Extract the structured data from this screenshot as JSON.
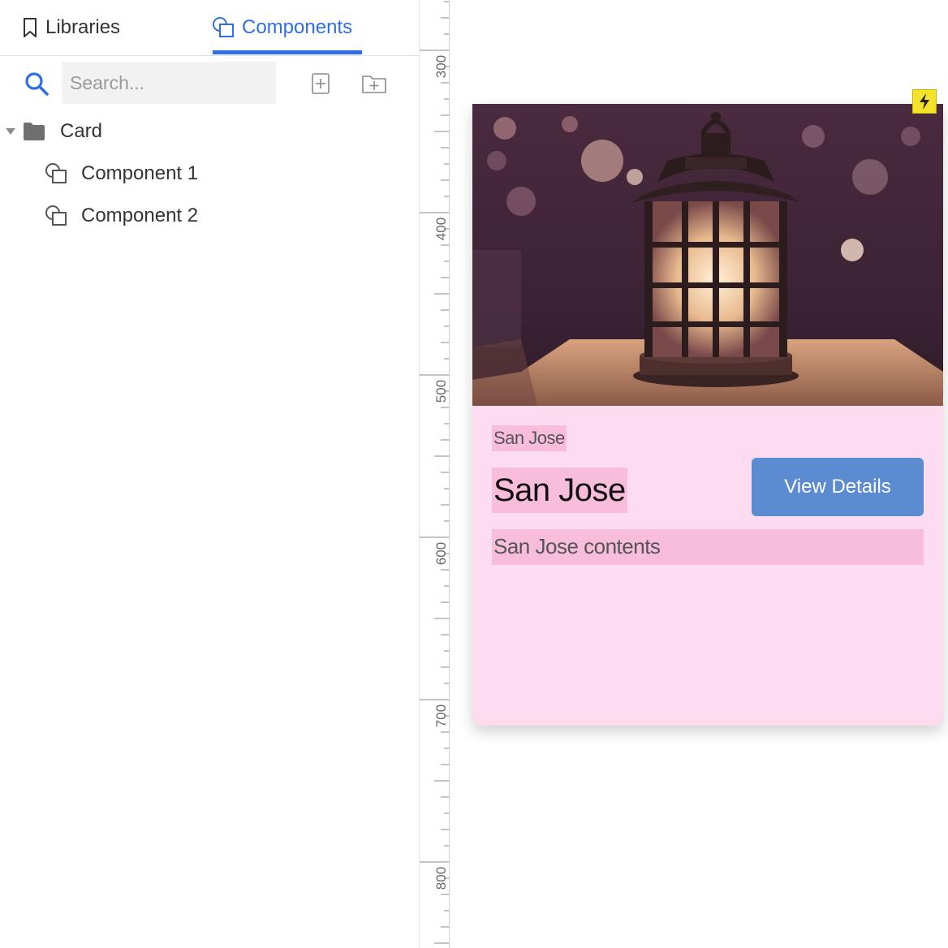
{
  "tabs": {
    "libraries_label": "Libraries",
    "components_label": "Components",
    "active": "components"
  },
  "search": {
    "placeholder": "Search...",
    "value": ""
  },
  "tree": {
    "folder": {
      "label": "Card",
      "expanded": true
    },
    "items": [
      {
        "label": "Component 1",
        "icon": "component-icon"
      },
      {
        "label": "Component 2",
        "icon": "component-icon"
      }
    ]
  },
  "ruler": {
    "labels": [
      "300",
      "400",
      "500",
      "600",
      "700",
      "800"
    ]
  },
  "card": {
    "subtitle": "San Jose",
    "title": "San Jose",
    "button_label": "View Details",
    "contents": "San Jose contents",
    "image_subject": "lantern-photo"
  },
  "colors": {
    "accent": "#2f6ee8",
    "card_bg": "#fcdcee",
    "text_highlight": "#f9bddc",
    "button_bg": "#5b8bd0",
    "badge": "#f5e22a"
  }
}
